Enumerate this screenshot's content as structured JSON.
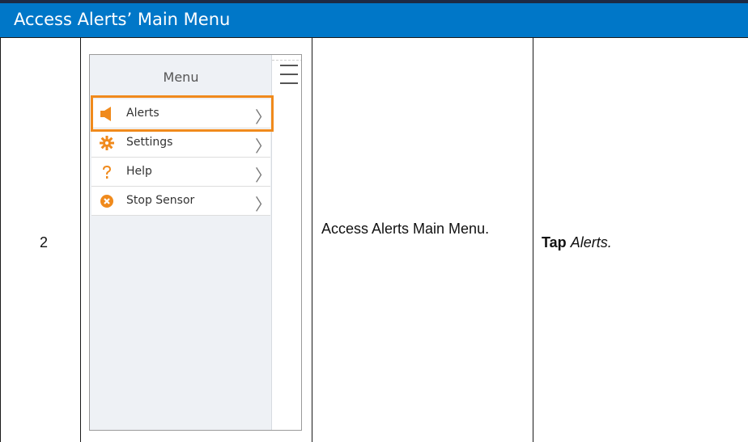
{
  "header": {
    "title": "Access Alerts’ Main Menu"
  },
  "row": {
    "step": "2",
    "action": "Access Alerts Main Menu.",
    "instruction_bold": "Tap",
    "instruction_italic": "Alerts."
  },
  "phone": {
    "menu_title": "Menu",
    "items": [
      {
        "label": "Alerts",
        "icon": "speaker-icon",
        "chevron": "〉",
        "highlighted": true
      },
      {
        "label": "Settings",
        "icon": "gear-icon",
        "chevron": "〉"
      },
      {
        "label": "Help",
        "icon": "question-icon",
        "chevron": "〉"
      },
      {
        "label": "Stop Sensor",
        "icon": "stop-icon",
        "chevron": "〉"
      }
    ],
    "highlight_color": "#f08a1c",
    "icon_color": "#f08a1c"
  },
  "colors": {
    "header_bg": "#0077c8",
    "header_border": "#1d2a44"
  }
}
